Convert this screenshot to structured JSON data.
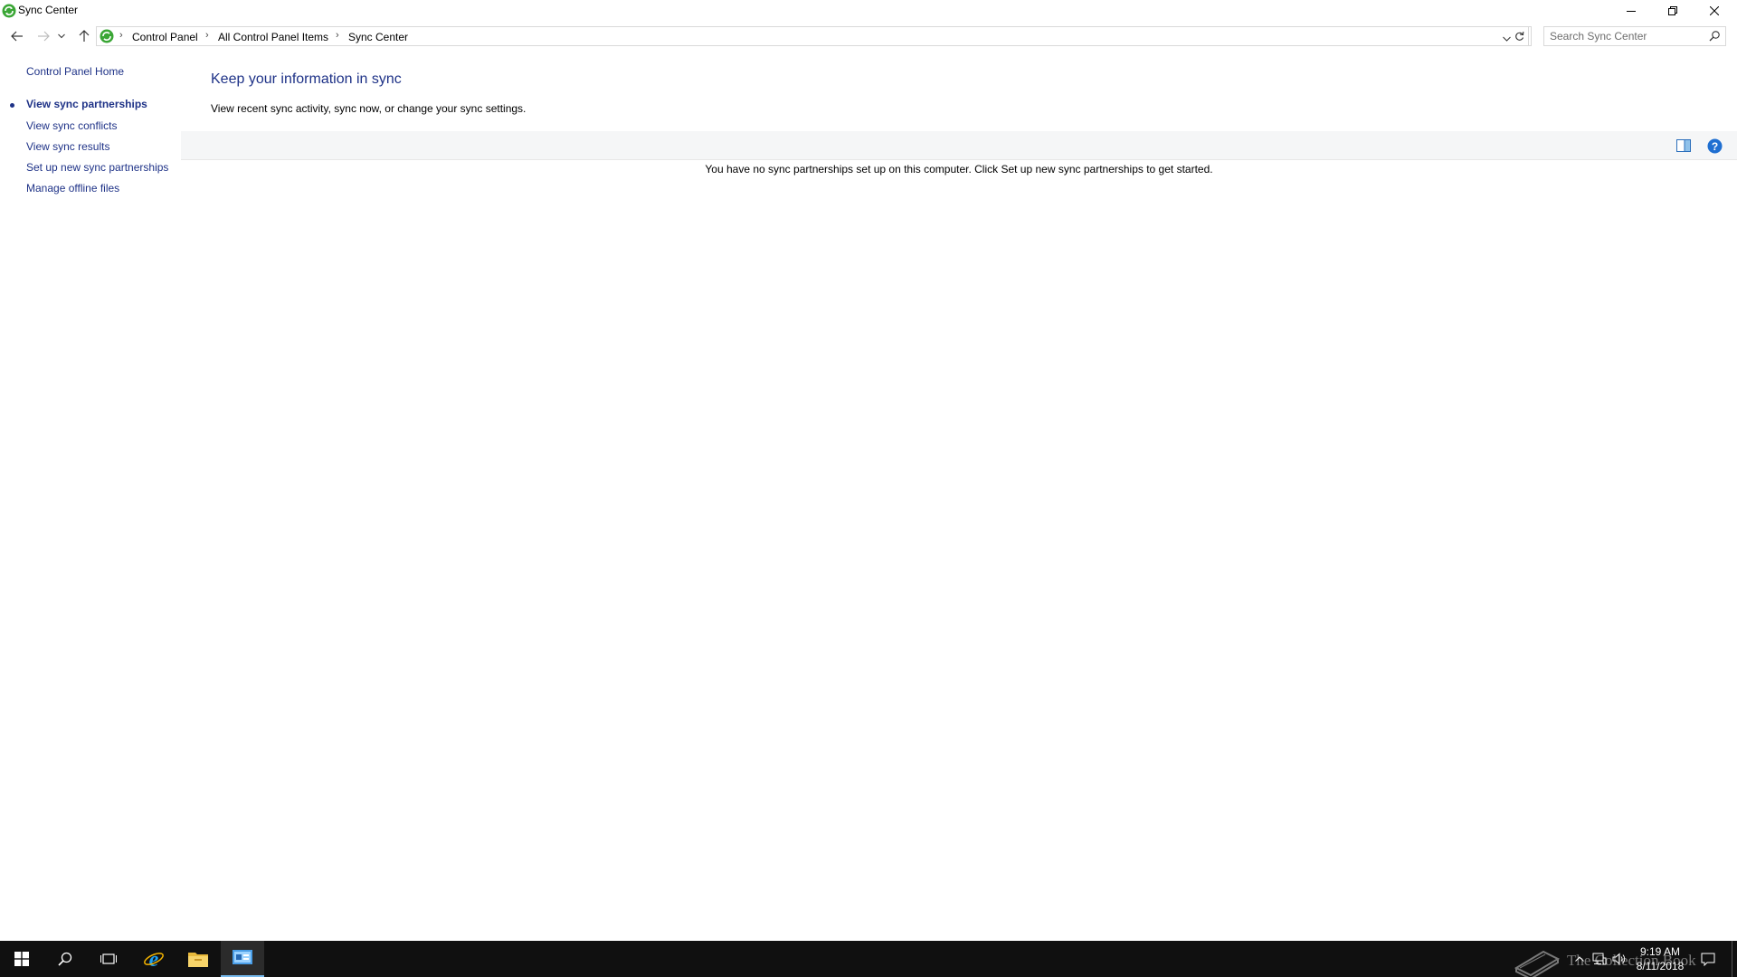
{
  "window": {
    "title": "Sync Center"
  },
  "address": {
    "crumbs": [
      "Control Panel",
      "All Control Panel Items",
      "Sync Center"
    ],
    "search_placeholder": "Search Sync Center"
  },
  "left_pane": {
    "home": "Control Panel Home",
    "links": [
      {
        "label": "View sync partnerships",
        "active": true
      },
      {
        "label": "View sync conflicts",
        "active": false
      },
      {
        "label": "View sync results",
        "active": false
      },
      {
        "label": "Set up new sync partnerships",
        "active": false
      },
      {
        "label": "Manage offline files",
        "active": false
      }
    ]
  },
  "main": {
    "heading": "Keep your information in sync",
    "description": "View recent sync activity, sync now, or change your sync settings.",
    "empty_message": "You have no sync partnerships set up on this computer. Click Set up new sync partnerships to get started."
  },
  "taskbar": {
    "apps": [
      "start-icon",
      "search-icon",
      "task-view-icon",
      "internet-explorer-icon",
      "file-explorer-icon",
      "control-panel-icon"
    ],
    "active_app": "control-panel-icon",
    "time": "9:19 AM",
    "date": "8/11/2018",
    "watermark": "The Collection Book"
  },
  "colors": {
    "link": "#1e3287",
    "toolbar_bg": "#f5f6f7",
    "taskbar_bg": "#101010",
    "sync_green": "#3aa635",
    "help_blue": "#1f6fd1"
  }
}
